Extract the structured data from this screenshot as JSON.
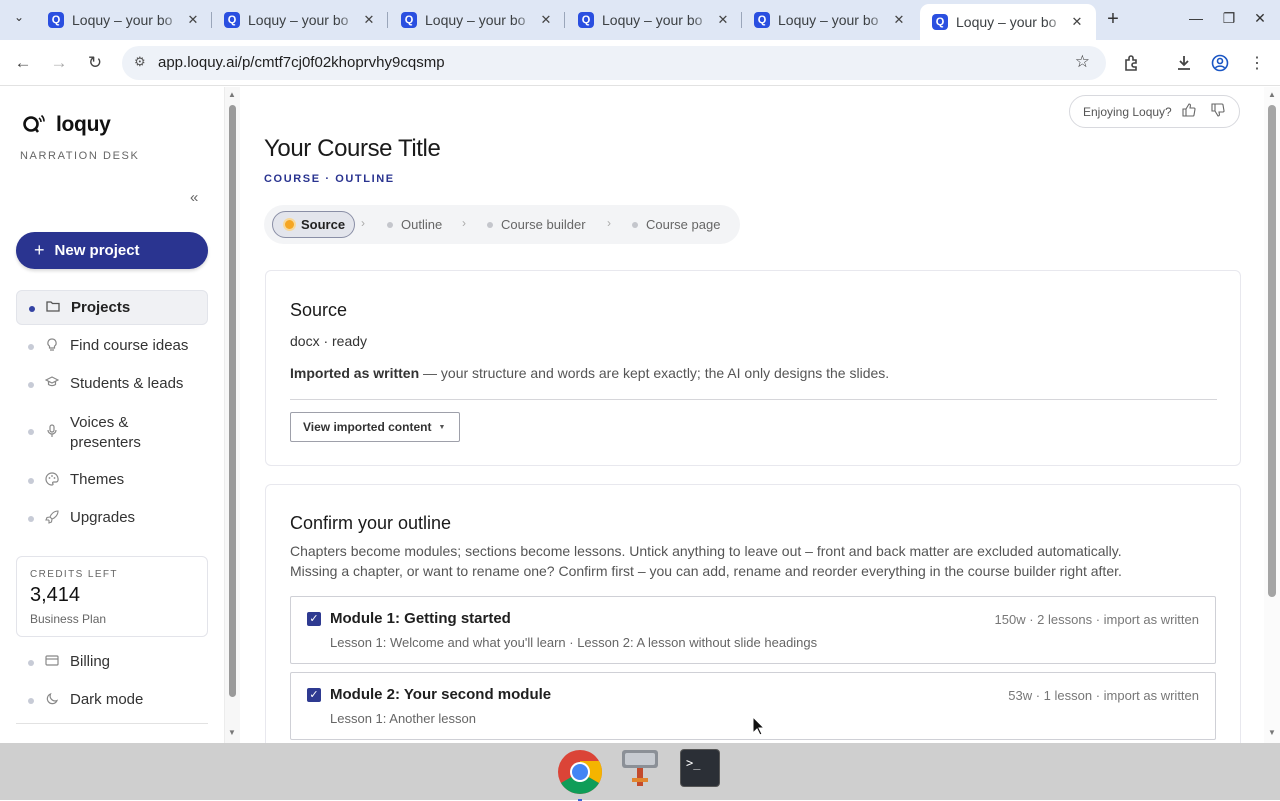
{
  "browser": {
    "tabs": [
      {
        "title": "Loquy – your bo",
        "favicon": "loquy-favicon"
      },
      {
        "title": "Loquy – your bo",
        "favicon": "loquy-favicon"
      },
      {
        "title": "Loquy – your bo",
        "favicon": "loquy-favicon"
      },
      {
        "title": "Loquy – your bo",
        "favicon": "loquy-favicon"
      },
      {
        "title": "Loquy – your bo",
        "favicon": "loquy-favicon"
      },
      {
        "title": "Loquy – your bo",
        "favicon": "loquy-favicon",
        "active": true
      }
    ],
    "favicon_letter": "Q",
    "url": "app.loquy.ai/p/cmtf7cj0f02khoprvhy9cqsmp"
  },
  "sidebar": {
    "logo_text": "loquy",
    "tagline": "NARRATION DESK",
    "collapse_glyph": "«",
    "new_project_label": "New project",
    "items": [
      {
        "label": "Projects",
        "icon": "folder-icon",
        "active": true
      },
      {
        "label": "Find course ideas",
        "icon": "lightbulb-icon"
      },
      {
        "label": "Students & leads",
        "icon": "graduation-cap-icon"
      },
      {
        "label": "Voices & presenters",
        "icon": "microphone-icon"
      },
      {
        "label": "Themes",
        "icon": "palette-icon"
      },
      {
        "label": "Upgrades",
        "icon": "rocket-icon"
      }
    ],
    "credits": {
      "label": "CREDITS LEFT",
      "value": "3,414",
      "plan": "Business Plan"
    },
    "bottom_items": [
      {
        "label": "Billing",
        "icon": "credit-card-icon"
      },
      {
        "label": "Dark mode",
        "icon": "moon-icon"
      }
    ]
  },
  "feedback": {
    "label": "Enjoying Loquy?"
  },
  "page": {
    "title": "Your Course Title",
    "subtitle": "COURSE · OUTLINE"
  },
  "stepper": [
    {
      "label": "Source",
      "active": true
    },
    {
      "label": "Outline"
    },
    {
      "label": "Course builder"
    },
    {
      "label": "Course page"
    }
  ],
  "source_card": {
    "heading": "Source",
    "meta": "docx · ready",
    "note_bold": "Imported as written",
    "note_rest": " — your structure and words are kept exactly; the AI only designs the slides.",
    "button_label": "View imported content"
  },
  "outline_card": {
    "heading": "Confirm your outline",
    "desc_line1": "Chapters become modules; sections become lessons. Untick anything to leave out – front and back matter are excluded automatically.",
    "desc_line2": "Missing a chapter, or want to rename one? Confirm first – you can add, rename and reorder everything in the course builder right after.",
    "modules": [
      {
        "title": "Module 1: Getting started",
        "stats": "150w · 2 lessons · import as written",
        "lessons": "Lesson 1: Welcome and what you'll learn · Lesson 2: A lesson without slide headings",
        "checked": true
      },
      {
        "title": "Module 2: Your second module",
        "stats": "53w · 1 lesson · import as written",
        "lessons": "Lesson 1: Another lesson",
        "checked": true
      }
    ]
  },
  "colors": {
    "brand": "#2a3490",
    "accent_active_dot": "#f5a623",
    "tab_strip": "#dfe7f5"
  }
}
